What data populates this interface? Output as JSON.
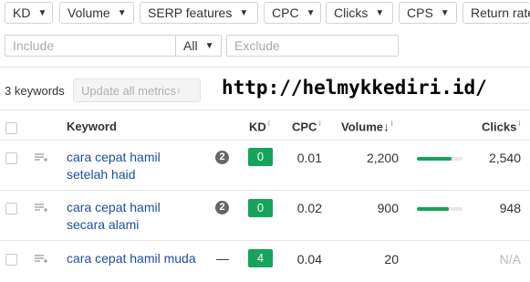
{
  "filters": [
    {
      "label": "KD"
    },
    {
      "label": "Volume"
    },
    {
      "label": "SERP features"
    },
    {
      "label": "CPC"
    },
    {
      "label": "Clicks"
    },
    {
      "label": "CPS"
    },
    {
      "label": "Return rate"
    }
  ],
  "search": {
    "include_placeholder": "Include",
    "scope": "All",
    "exclude_placeholder": "Exclude"
  },
  "summary": {
    "count": "3 keywords",
    "update_label": "Update all metrics",
    "info": "i"
  },
  "watermark": "http://helmykkediri.id/",
  "table": {
    "headers": {
      "keyword": "Keyword",
      "kd": "KD",
      "cpc": "CPC",
      "volume": "Volume",
      "clicks": "Clicks",
      "info": "i",
      "sort_arrow": "↓"
    },
    "rows": [
      {
        "keyword_line1": "cara cepat hamil",
        "keyword_line2": "setelah haid",
        "serp": "2",
        "kd": "0",
        "kd_color": "#16a35a",
        "cpc": "0.01",
        "volume": "2,200",
        "volume_fraction": 0.75,
        "clicks": "2,540"
      },
      {
        "keyword_line1": "cara cepat hamil",
        "keyword_line2": "secara alami",
        "serp": "2",
        "kd": "0",
        "kd_color": "#16a35a",
        "cpc": "0.02",
        "volume": "900",
        "volume_fraction": 0.7,
        "clicks": "948"
      },
      {
        "keyword_line1": "cara cepat hamil muda",
        "keyword_line2": "",
        "serp": "—",
        "kd": "4",
        "kd_color": "#16a35a",
        "cpc": "0.04",
        "volume": "20",
        "volume_fraction": 0,
        "clicks": "N/A"
      }
    ]
  }
}
